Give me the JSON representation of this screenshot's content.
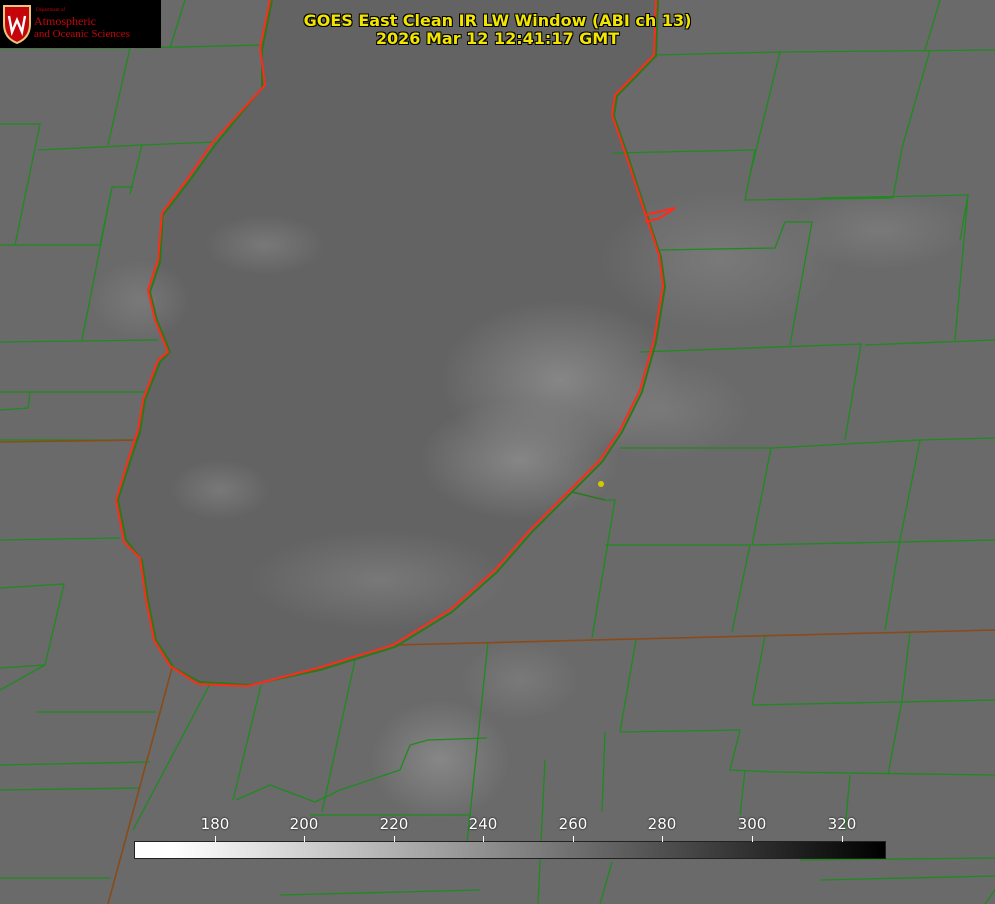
{
  "header": {
    "title_line1": "GOES East Clean IR LW Window (ABI ch 13)",
    "title_line2": "2026 Mar 12 12:41:17 GMT"
  },
  "logo": {
    "dept": "Department of",
    "line1": "Atmospheric",
    "line2": "and Oceanic Sciences"
  },
  "colorbar": {
    "ticks": [
      "180",
      "200",
      "220",
      "240",
      "260",
      "280",
      "300",
      "320"
    ]
  },
  "colors": {
    "title": "#f2e600",
    "shoreline": "#ff2a1a",
    "borders": "#1f8a1f",
    "background": "#676767"
  }
}
